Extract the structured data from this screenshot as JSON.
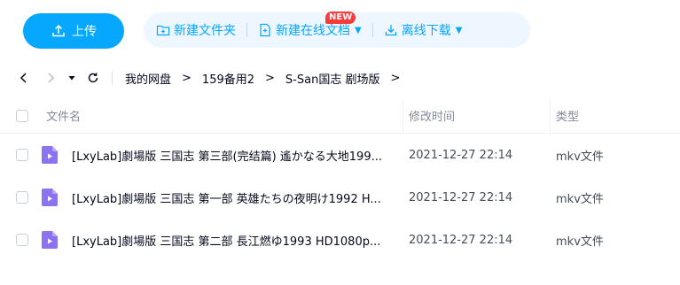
{
  "toolbar": {
    "upload_label": "上传",
    "new_folder_label": "新建文件夹",
    "new_online_doc_label": "新建在线文档",
    "new_badge": "NEW",
    "offline_download_label": "离线下载"
  },
  "breadcrumb": {
    "items": [
      "我的网盘",
      "159备用2",
      "S-San国志 剧场版"
    ],
    "separator": ">"
  },
  "table": {
    "headers": {
      "name": "文件名",
      "time": "修改时间",
      "type": "类型"
    },
    "rows": [
      {
        "name": "[LxyLab]劇場版 三国志 第三部(完结篇) 遙かなる大地199...",
        "time": "2021-12-27 22:14",
        "type": "mkv文件"
      },
      {
        "name": "[LxyLab]劇場版 三国志 第一部 英雄たちの夜明け1992 H...",
        "time": "2021-12-27 22:14",
        "type": "mkv文件"
      },
      {
        "name": "[LxyLab]劇場版 三国志 第二部 長江燃ゆ1993 HD1080p...",
        "time": "2021-12-27 22:14",
        "type": "mkv文件"
      }
    ]
  },
  "colors": {
    "accent": "#06a7ff",
    "toolbar_group_bg": "#eef6ff",
    "badge": "#fa3b3b",
    "video_icon": "#8d73f0"
  }
}
